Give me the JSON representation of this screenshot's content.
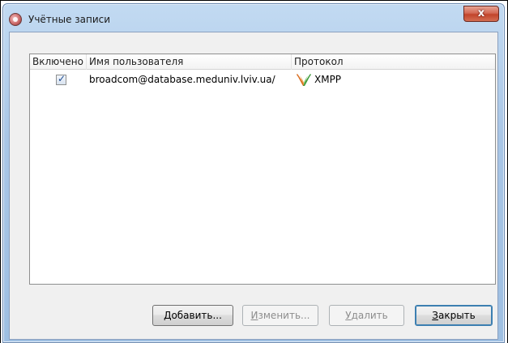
{
  "window": {
    "title": "Учётные записи",
    "close_glyph": "x"
  },
  "table": {
    "columns": [
      "Включено",
      "Имя пользователя",
      "Протокол"
    ],
    "rows": [
      {
        "enabled": true,
        "user": "broadcom@database.meduniv.lviv.ua/",
        "protocol": "XMPP",
        "protocol_icon": "xmpp-icon"
      }
    ]
  },
  "buttons": {
    "add": {
      "mnemonic": "Д",
      "rest": "обавить...",
      "enabled": true
    },
    "edit": {
      "mnemonic": "И",
      "rest": "зменить...",
      "enabled": false
    },
    "delete": {
      "mnemonic": "У",
      "rest": "далить",
      "enabled": false
    },
    "close": {
      "mnemonic": "З",
      "rest": "акрыть",
      "enabled": true
    }
  },
  "colors": {
    "accent": "#3c7fb1",
    "close_button": "#c2442b",
    "checkbox_mark": "#1d4b91"
  }
}
